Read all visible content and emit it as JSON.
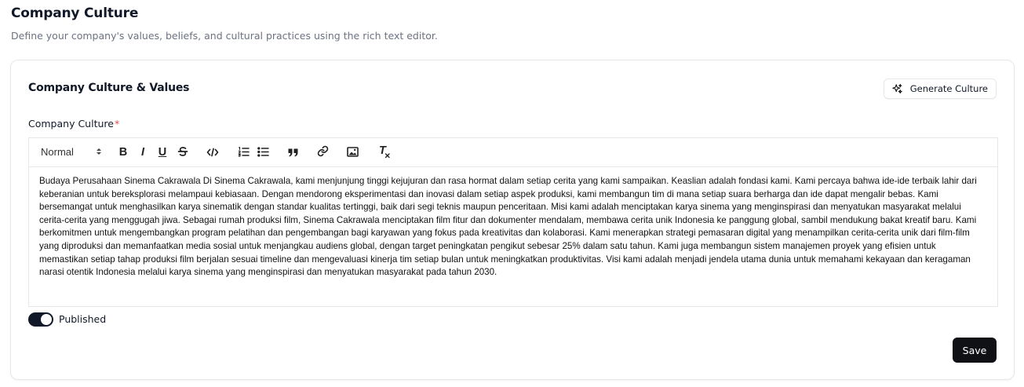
{
  "page": {
    "title": "Company Culture",
    "subtitle": "Define your company's values, beliefs, and cultural practices using the rich text editor."
  },
  "card": {
    "title": "Company Culture & Values",
    "generate_button": {
      "label": "Generate Culture",
      "icon": "sparkles-icon"
    }
  },
  "field": {
    "label": "Company Culture",
    "required_marker": "*"
  },
  "editor": {
    "format_select": {
      "value": "Normal"
    },
    "toolbar": [
      "bold",
      "italic",
      "underline",
      "strikethrough",
      "code-block",
      "ordered-list",
      "bullet-list",
      "blockquote",
      "link",
      "image",
      "clear-formatting"
    ],
    "toolbar_text": {
      "bold": "B",
      "italic": "I",
      "underline": "U",
      "clear": "T"
    },
    "content": "Budaya Perusahaan Sinema Cakrawala Di Sinema Cakrawala, kami menjunjung tinggi kejujuran dan rasa hormat dalam setiap cerita yang kami sampaikan. Keaslian adalah fondasi kami. Kami percaya bahwa ide-ide terbaik lahir dari keberanian untuk bereksplorasi melampaui kebiasaan. Dengan mendorong eksperimentasi dan inovasi dalam setiap aspek produksi, kami membangun tim di mana setiap suara berharga dan ide dapat mengalir bebas. Kami bersemangat untuk menghasilkan karya sinematik dengan standar kualitas tertinggi, baik dari segi teknis maupun penceritaan. Misi kami adalah menciptakan karya sinema yang menginspirasi dan menyatukan masyarakat melalui cerita-cerita yang menggugah jiwa. Sebagai rumah produksi film, Sinema Cakrawala menciptakan film fitur dan dokumenter mendalam, membawa cerita unik Indonesia ke panggung global, sambil mendukung bakat kreatif baru. Kami berkomitmen untuk mengembangkan program pelatihan dan pengembangan bagi karyawan yang fokus pada kreativitas dan kolaborasi. Kami menerapkan strategi pemasaran digital yang menampilkan cerita-cerita unik dari film-film yang diproduksi dan memanfaatkan media sosial untuk menjangkau audiens global, dengan target peningkatan pengikut sebesar 25% dalam satu tahun. Kami juga membangun sistem manajemen proyek yang efisien untuk memastikan setiap tahap produksi film berjalan sesuai timeline dan mengevaluasi kinerja tim setiap bulan untuk meningkatkan produktivitas. Visi kami adalah menjadi jendela utama dunia untuk memahami kekayaan dan keragaman narasi otentik Indonesia melalui karya sinema yang menginspirasi dan menyatukan masyarakat pada tahun 2030."
  },
  "publish": {
    "label": "Published",
    "checked": true
  },
  "save_button": {
    "label": "Save"
  },
  "colors": {
    "primary": "#0f1115",
    "required": "#ef4444",
    "muted_text": "#6b7280",
    "border": "#e5e7eb"
  }
}
